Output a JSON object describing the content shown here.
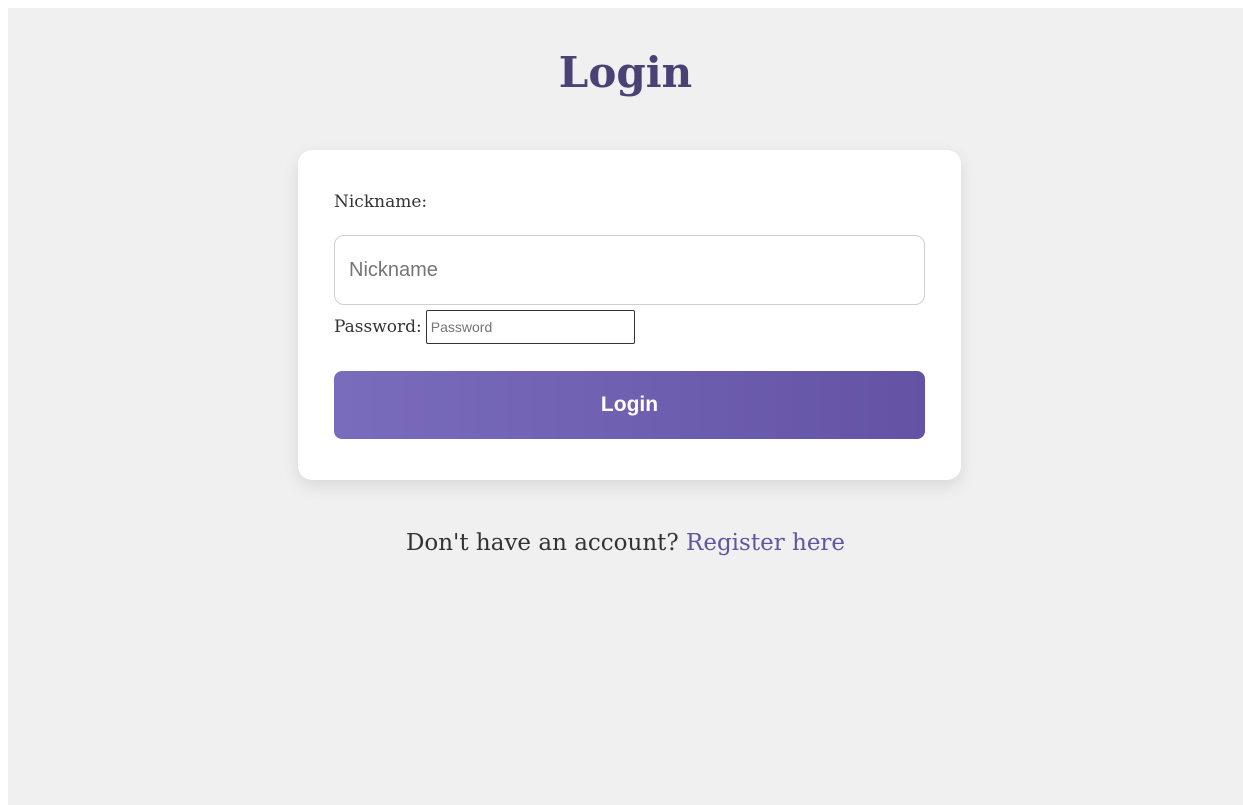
{
  "page": {
    "title": "Login"
  },
  "form": {
    "nickname_label": "Nickname:",
    "nickname_placeholder": "Nickname",
    "nickname_value": "",
    "password_label": "Password:",
    "password_placeholder": "Password",
    "password_value": "",
    "submit_label": "Login"
  },
  "footer": {
    "prompt": "Don't have an account?",
    "register_link": "Register here"
  },
  "colors": {
    "background": "#f0f0f0",
    "title": "#4a4275",
    "button_gradient_start": "#7a6cbd",
    "button_gradient_end": "#6453a4",
    "link": "#5f56a0"
  }
}
